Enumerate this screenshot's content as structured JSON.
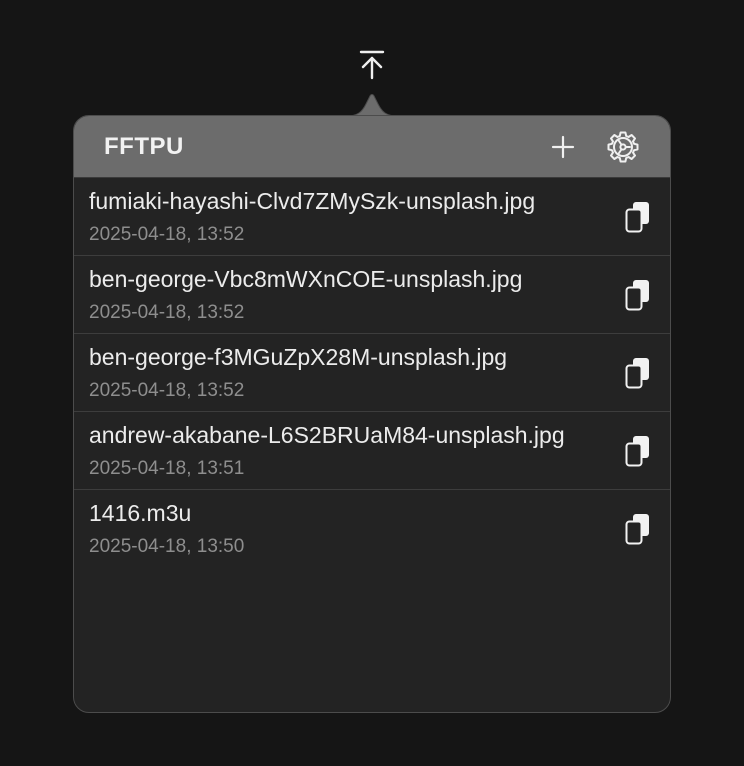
{
  "app": {
    "title": "FFTPU",
    "menubar_icon": "upload-arrow-icon"
  },
  "header": {
    "add_icon": "plus-icon",
    "settings_icon": "gear-icon"
  },
  "files": [
    {
      "name": "fumiaki-hayashi-Clvd7ZMySzk-unsplash.jpg",
      "date": "2025-04-18, 13:52",
      "action_icon": "copy-icon"
    },
    {
      "name": "ben-george-Vbc8mWXnCOE-unsplash.jpg",
      "date": "2025-04-18, 13:52",
      "action_icon": "copy-icon"
    },
    {
      "name": "ben-george-f3MGuZpX28M-unsplash.jpg",
      "date": "2025-04-18, 13:52",
      "action_icon": "copy-icon"
    },
    {
      "name": "andrew-akabane-L6S2BRUaM84-unsplash.jpg",
      "date": "2025-04-18, 13:51",
      "action_icon": "copy-icon"
    },
    {
      "name": "1416.m3u",
      "date": "2025-04-18, 13:50",
      "action_icon": "copy-icon"
    }
  ]
}
